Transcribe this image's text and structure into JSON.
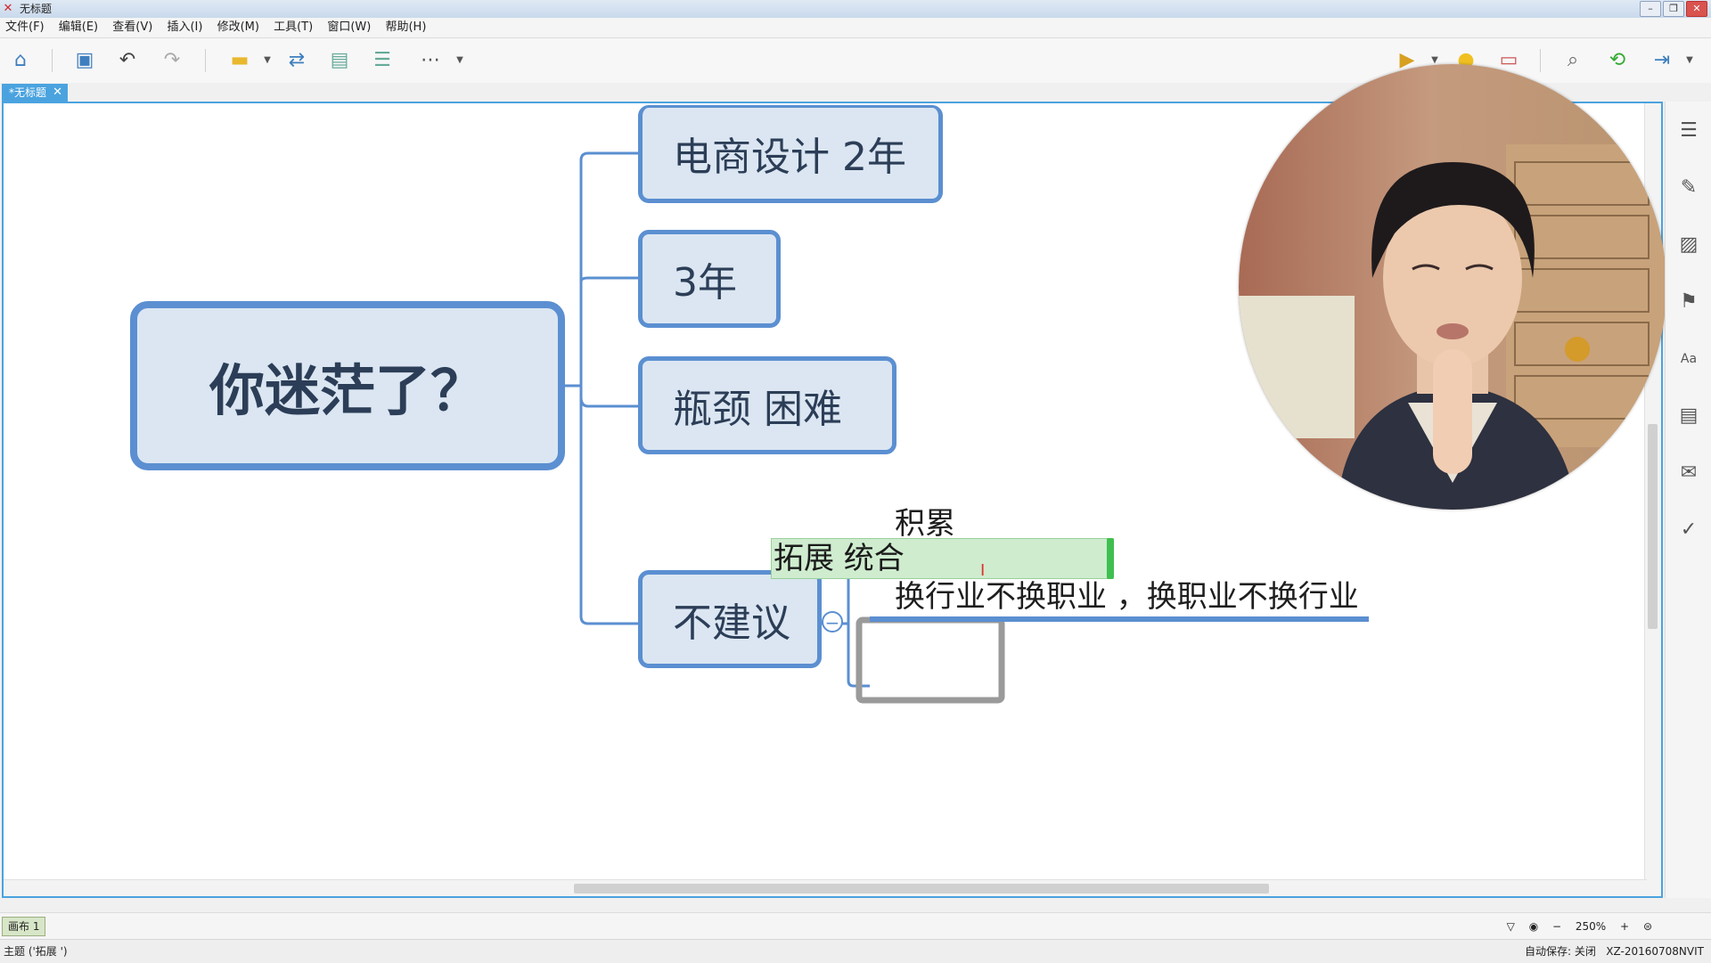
{
  "window": {
    "title": "无标题",
    "minimize": "–",
    "restore": "❐",
    "close": "✕"
  },
  "menu": [
    "文件(F)",
    "编辑(E)",
    "查看(V)",
    "插入(I)",
    "修改(M)",
    "工具(T)",
    "窗口(W)",
    "帮助(H)"
  ],
  "tab": {
    "label": "*无标题",
    "close": "✕"
  },
  "mindmap": {
    "central": "你迷茫了？",
    "branches": [
      "电商设计  2年",
      "3年",
      "瓶颈  困难",
      "不建议"
    ],
    "sub_topics": [
      "积累",
      "换行业不换职业 ，换职业不换行业"
    ],
    "collapse_symbol": "−",
    "editing_text": "拓展 统合"
  },
  "bottom": {
    "sheet_tab": "画布 1",
    "zoom_minus": "−",
    "zoom_level": "250%",
    "zoom_plus": "+"
  },
  "status": {
    "left": "主题 ('拓展 ')",
    "autosave": "自动保存: 关闭",
    "computer": "XZ-20160708NVIT"
  },
  "colors": {
    "accent": "#4aa3df",
    "node_fill": "#dbe6f2",
    "node_border": "#5b8fd1",
    "edit_fill": "#cfeccf"
  }
}
